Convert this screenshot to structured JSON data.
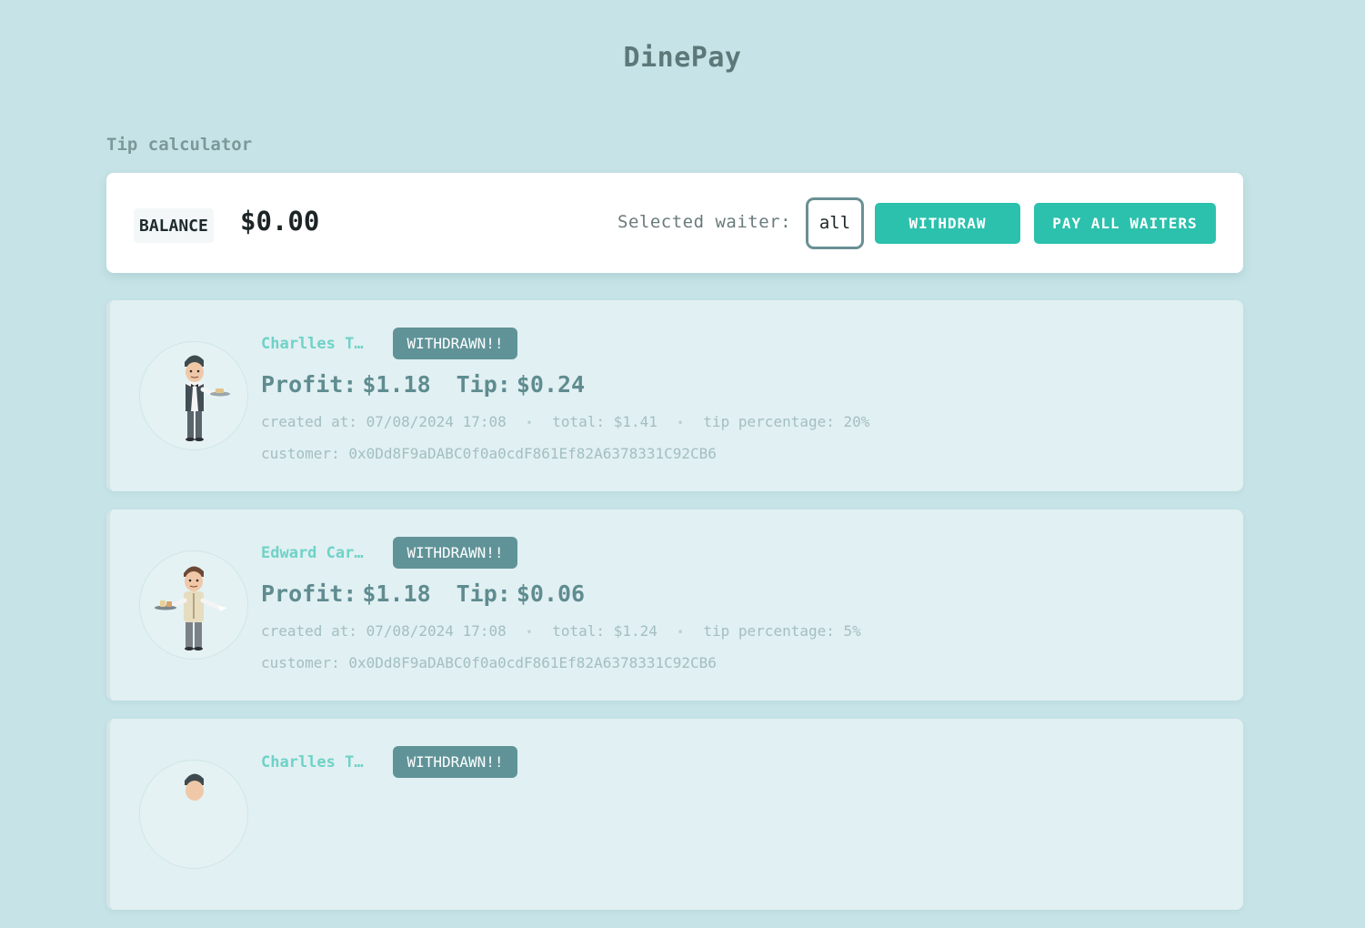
{
  "app": {
    "title": "DinePay"
  },
  "section": {
    "title": "Tip calculator"
  },
  "toolbar": {
    "balance_label": "BALANCE",
    "balance_value": "$0.00",
    "waiter_label": "Selected waiter:",
    "waiter_value": "all",
    "withdraw_label": "WITHDRAW",
    "pay_all_label": "PAY ALL WAITERS"
  },
  "cards": [
    {
      "name": "Charlles T…",
      "status": "WITHDRAWN!!",
      "profit_label": "Profit:",
      "profit": "$1.18",
      "tip_label": "Tip:",
      "tip": "$0.24",
      "created_label": "created at:",
      "created": "07/08/2024 17:08",
      "total_label": "total:",
      "total": "$1.41",
      "tip_pct_label": "tip percentage:",
      "tip_pct": "20%",
      "customer_label": "customer:",
      "customer": "0x0Dd8F9aDABC0f0a0cdF861Ef82A6378331C92CB6"
    },
    {
      "name": "Edward Car…",
      "status": "WITHDRAWN!!",
      "profit_label": "Profit:",
      "profit": "$1.18",
      "tip_label": "Tip:",
      "tip": "$0.06",
      "created_label": "created at:",
      "created": "07/08/2024 17:08",
      "total_label": "total:",
      "total": "$1.24",
      "tip_pct_label": "tip percentage:",
      "tip_pct": "5%",
      "customer_label": "customer:",
      "customer": "0x0Dd8F9aDABC0f0a0cdF861Ef82A6378331C92CB6"
    },
    {
      "name": "Charlles T…",
      "status": "WITHDRAWN!!"
    }
  ],
  "colors": {
    "background": "#c6e4e7",
    "accent": "#2cc1ad",
    "badge": "#5f9398",
    "name": "#6fd2c7"
  },
  "icons": {
    "avatar": "waiter-avatar-icon",
    "separator": "bullet"
  }
}
